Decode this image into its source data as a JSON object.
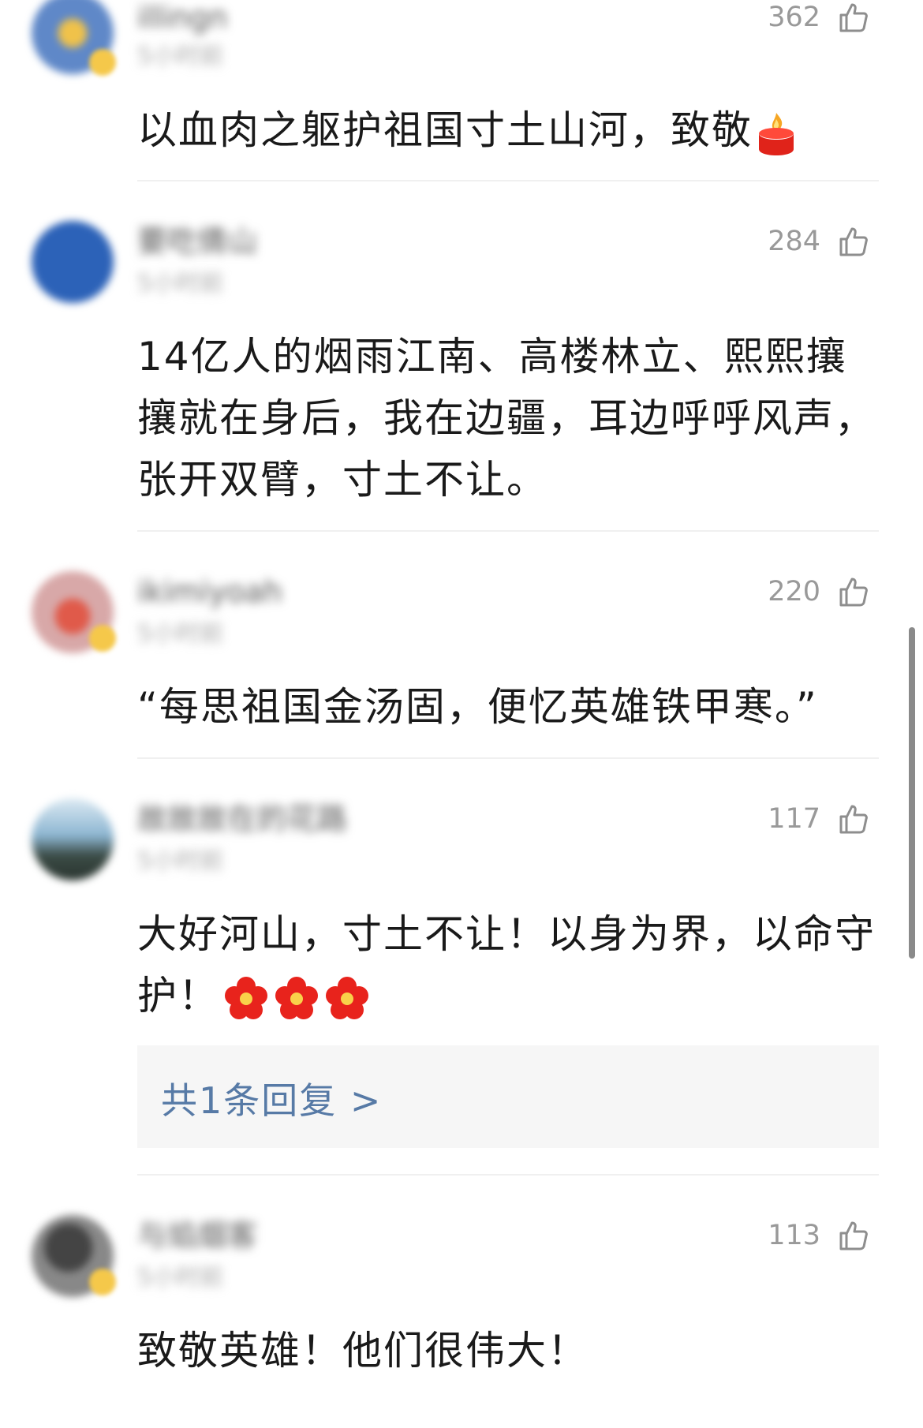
{
  "comments": [
    {
      "username": "illingn",
      "meta": "5小时前",
      "likes": "362",
      "text": "以血肉之躯护祖国寸土山河，致敬",
      "emoji": "candle-emoji",
      "avatar_color": "#5f88c8"
    },
    {
      "username": "要吃倩山",
      "meta": "5小时前",
      "likes": "284",
      "text": "14亿人的烟雨江南、高楼林立、熙熙攘攘就在身后，我在边疆，耳边呼呼风声，张开双臂，寸土不让。",
      "avatar_color": "#2c62b8"
    },
    {
      "username": "ikimiyoah",
      "meta": "5小时前",
      "likes": "220",
      "text": "“每思祖国金汤固，便忆英雄铁甲寒。”",
      "avatar_color": "#d8a8a8"
    },
    {
      "username": "故故故在的花路",
      "meta": "5小时前",
      "likes": "117",
      "text": "大好河山，寸土不让！以身为界，以命守护！",
      "emoji": "flower-emoji",
      "emoji_count": 3,
      "reply_link": "共1条回复 >",
      "avatar_color": "#7aa6c8"
    },
    {
      "username": "与焰烟客",
      "meta": "5小时前",
      "likes": "113",
      "text": "致敬英雄！他们很伟大！",
      "avatar_color": "#333333"
    }
  ],
  "colors": {
    "link": "#577aa6",
    "text": "#1a1a1a",
    "likes": "#999999",
    "reply_bg": "#f6f6f6"
  }
}
